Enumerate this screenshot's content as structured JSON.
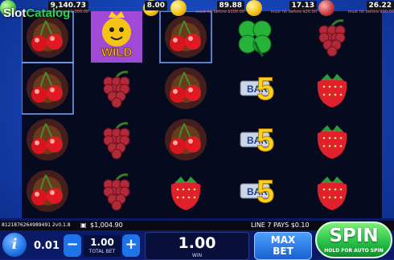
{
  "logo": {
    "prefix": "Slot",
    "suffix": "Catalog"
  },
  "jackpots": [
    {
      "value": "9,140.73",
      "note": "must hit before 11,000.00",
      "coin": "#46c73a"
    },
    {
      "value": "8.00",
      "note": "",
      "coin": "#f4c313"
    },
    {
      "value": "89.88",
      "note": "must hit before $100.00",
      "coin": "#f4c313"
    },
    {
      "value": "17.13",
      "note": "must hit before $20.00",
      "coin": "#f4c313"
    },
    {
      "value": "26.22",
      "note": "must hit before $30.00",
      "coin": "#c33a3a"
    }
  ],
  "wild_label": "WILD",
  "bar_label": "BAR",
  "five_label": "5",
  "info": {
    "balance": "$1,004.90",
    "win_line": "LINE 7 PAYS $0.10",
    "game_id": "8121876264989491 2v0.1.8"
  },
  "controls": {
    "info_icon": "i",
    "coin_value": "0.01",
    "minus": "−",
    "plus": "+",
    "total_bet_value": "1.00",
    "total_bet_label": "TOTAL BET",
    "win_value": "1.00",
    "win_label": "WIN",
    "max_bet_label_1": "MAX",
    "max_bet_label_2": "BET",
    "spin_label": "SPIN",
    "spin_sub": "HOLD FOR AUTO SPIN"
  },
  "reels": [
    [
      "cherry",
      "cherry",
      "cherry",
      "cherry"
    ],
    [
      "wild",
      "grapes",
      "grapes",
      "grapes"
    ],
    [
      "cherry",
      "cherry",
      "cherry",
      "strawberry"
    ],
    [
      "clover",
      "bar5",
      "bar5",
      "bar5"
    ],
    [
      "grapes",
      "strawberry",
      "strawberry",
      "strawberry"
    ]
  ],
  "colors": {
    "accent": "#2fd34f",
    "button_blue": "#1e74e6",
    "spin_green": "#2bc34a"
  }
}
